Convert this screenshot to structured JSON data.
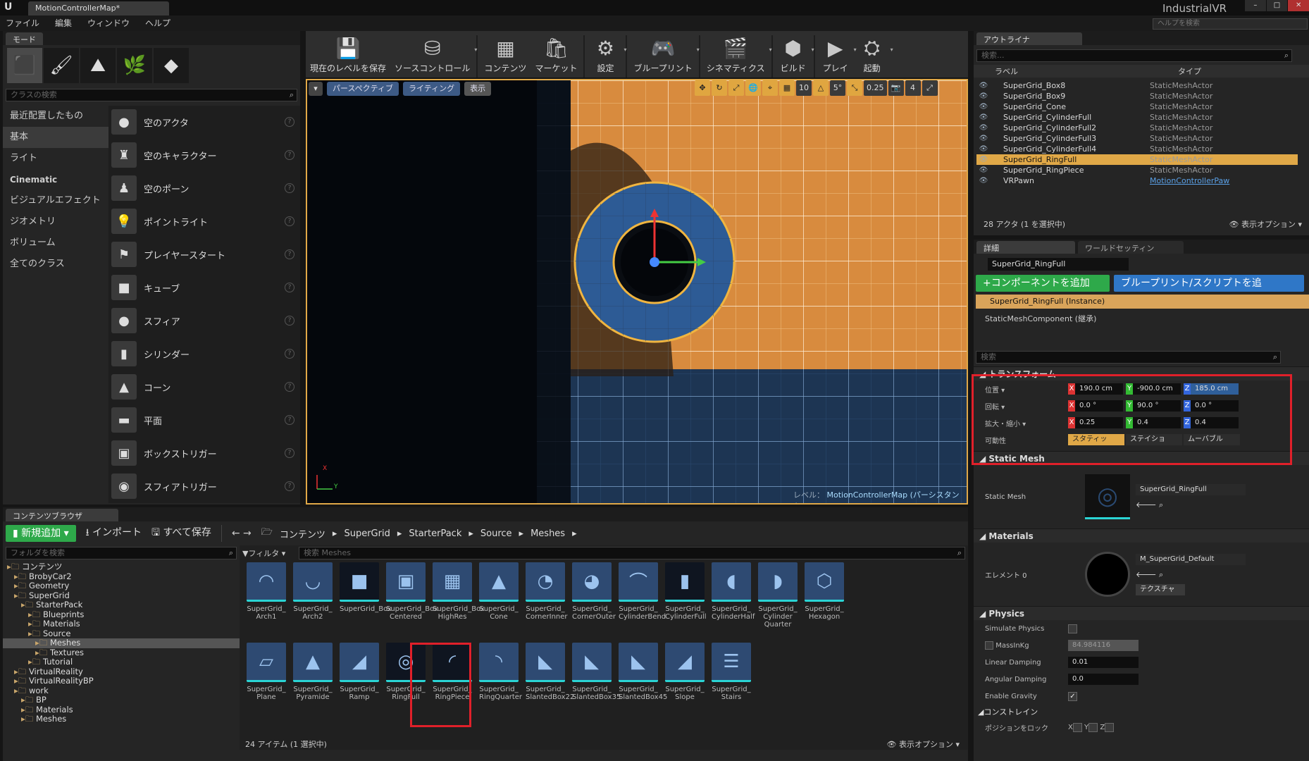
{
  "app": {
    "tab_title": "MotionControllerMap*",
    "project": "IndustrialVR",
    "help_search_placeholder": "ヘルプを検索",
    "logo": "U"
  },
  "menu": [
    "ファイル",
    "編集",
    "ウィンドウ",
    "ヘルプ"
  ],
  "modes": {
    "tab": "モード",
    "search_placeholder": "クラスの検索",
    "categories": [
      "最近配置したもの",
      "基本",
      "ライト",
      "Cinematic",
      "ビジュアルエフェクト",
      "ジオメトリ",
      "ボリューム",
      "全てのクラス"
    ],
    "items": [
      {
        "label": "空のアクタ",
        "icon": "●"
      },
      {
        "label": "空のキャラクター",
        "icon": "♜"
      },
      {
        "label": "空のポーン",
        "icon": "♟"
      },
      {
        "label": "ポイントライト",
        "icon": "💡"
      },
      {
        "label": "プレイヤースタート",
        "icon": "⚑"
      },
      {
        "label": "キューブ",
        "icon": "■"
      },
      {
        "label": "スフィア",
        "icon": "●"
      },
      {
        "label": "シリンダー",
        "icon": "▮"
      },
      {
        "label": "コーン",
        "icon": "▲"
      },
      {
        "label": "平面",
        "icon": "▬"
      },
      {
        "label": "ボックストリガー",
        "icon": "▣"
      },
      {
        "label": "スフィアトリガー",
        "icon": "◉"
      }
    ]
  },
  "toolbar": [
    {
      "label": "現在のレベルを保存",
      "icon": "💾",
      "arrow": ""
    },
    {
      "label": "ソースコントロール",
      "icon": "⛁",
      "arrow": "▾"
    },
    {
      "label": "コンテンツ",
      "icon": "▦",
      "arrow": ""
    },
    {
      "label": "マーケット",
      "icon": "🛍",
      "arrow": ""
    },
    {
      "label": "設定",
      "icon": "⚙",
      "arrow": "▾"
    },
    {
      "label": "ブループリント",
      "icon": "🎮",
      "arrow": "▾"
    },
    {
      "label": "シネマティクス",
      "icon": "🎬",
      "arrow": "▾"
    },
    {
      "label": "ビルド",
      "icon": "⬢",
      "arrow": "▾"
    },
    {
      "label": "プレイ",
      "icon": "▶",
      "arrow": "▾"
    },
    {
      "label": "起動",
      "icon": "⛭",
      "arrow": "▾"
    }
  ],
  "viewport": {
    "perspective": "パースペクティブ",
    "lighting": "ライティング",
    "show": "表示",
    "grid_snap": "5°",
    "scale_snap": "0.25",
    "cam_speed": "4",
    "level_label": "レベル：",
    "level_name": "MotionControllerMap (パーシスタント)",
    "axis_x": "X",
    "axis_y": "Y"
  },
  "outliner": {
    "tab": "アウトライナ",
    "search_placeholder": "検索...",
    "col_label": "ラベル",
    "col_type": "タイプ",
    "rows": [
      {
        "name": "SuperGrid_Box8",
        "type": "StaticMeshActor"
      },
      {
        "name": "SuperGrid_Box9",
        "type": "StaticMeshActor"
      },
      {
        "name": "SuperGrid_Cone",
        "type": "StaticMeshActor"
      },
      {
        "name": "SuperGrid_CylinderFull",
        "type": "StaticMeshActor"
      },
      {
        "name": "SuperGrid_CylinderFull2",
        "type": "StaticMeshActor"
      },
      {
        "name": "SuperGrid_CylinderFull3",
        "type": "StaticMeshActor"
      },
      {
        "name": "SuperGrid_CylinderFull4",
        "type": "StaticMeshActor"
      },
      {
        "name": "SuperGrid_RingFull",
        "type": "StaticMeshActor"
      },
      {
        "name": "SuperGrid_RingPiece",
        "type": "StaticMeshActor"
      },
      {
        "name": "VRPawn",
        "type": "MotionControllerPaw"
      }
    ],
    "status": "28 アクタ (1 を選択中)",
    "view_options": "表示オプション"
  },
  "details": {
    "tab": "詳細",
    "tab2": "ワールドセッティン",
    "name": "SuperGrid_RingFull",
    "add_component": "+コンポーネントを追加",
    "blueprint": "ブループリント/スクリプトを追",
    "instance": "SuperGrid_RingFull (Instance)",
    "component": "StaticMeshComponent (継承)",
    "search_placeholder": "検索",
    "transform": {
      "header": "トランスフォーム",
      "location_label": "位置",
      "rotation_label": "回転",
      "scale_label": "拡大・縮小",
      "mobility_label": "可動性",
      "loc": [
        "190.0 cm",
        "-900.0 cm",
        "185.0 cm"
      ],
      "rot": [
        "0.0 °",
        "90.0 °",
        "0.0 °"
      ],
      "scale": [
        "0.25",
        "0.4",
        "0.4"
      ],
      "mobility": [
        "スタティッ",
        "ステイショ",
        "ムーバブル"
      ]
    },
    "static_mesh": {
      "header": "Static Mesh",
      "label": "Static Mesh",
      "value": "SuperGrid_RingFull"
    },
    "materials": {
      "header": "Materials",
      "label": "エレメント 0",
      "value": "M_SuperGrid_Default",
      "texture": "テクスチャ"
    },
    "physics": {
      "header": "Physics",
      "simulate": "Simulate Physics",
      "mass": "MassInKg",
      "mass_val": "84.984116",
      "lin_damp": "Linear Damping",
      "lin_val": "0.01",
      "ang_damp": "Angular Damping",
      "ang_val": "0.0",
      "gravity": "Enable Gravity"
    },
    "constraints": {
      "header": "コンストレイン",
      "lock_pos": "ポジションをロック",
      "x": "X",
      "y": "Y",
      "z": "Z"
    }
  },
  "content": {
    "tab": "コンテンツブラウザ",
    "add_new": "新規追加",
    "import": "インポート",
    "save_all": "すべて保存",
    "breadcrumb": [
      "コンテンツ",
      "SuperGrid",
      "StarterPack",
      "Source",
      "Meshes"
    ],
    "folder_search": "フォルダを検索",
    "filter": "フィルタ",
    "asset_search": "検索 Meshes",
    "tree": [
      "コンテンツ",
      "BrobyCar2",
      "Geometry",
      "SuperGrid",
      "StarterPack",
      "Blueprints",
      "Materials",
      "Source",
      "Meshes",
      "Textures",
      "Tutorial",
      "VirtualReality",
      "VirtualRealityBP",
      "work",
      "BP",
      "Materials",
      "Meshes"
    ],
    "assets_row1": [
      "SuperGrid_\nArch1",
      "SuperGrid_\nArch2",
      "SuperGrid_Box",
      "SuperGrid_Box\nCentered",
      "SuperGrid_Box\nHighRes",
      "SuperGrid_\nCone",
      "SuperGrid_\nCornerInner",
      "SuperGrid_\nCornerOuter",
      "SuperGrid_\nCylinderBend",
      "SuperGrid_\nCylinderFull",
      "SuperGrid_\nCylinderHalf",
      "SuperGrid_\nCylinder\nQuarter",
      "SuperGrid_\nHexagon"
    ],
    "assets_row2": [
      "SuperGrid_\nPlane",
      "SuperGrid_\nPyramide",
      "SuperGrid_\nRamp",
      "SuperGrid_\nRingFull",
      "SuperGrid_\nRingPiece",
      "SuperGrid_\nRingQuarter",
      "SuperGrid_\nSlantedBox22",
      "SuperGrid_\nSlantedBox35",
      "SuperGrid_\nSlantedBox45",
      "SuperGrid_\nSlope",
      "SuperGrid_\nStairs"
    ],
    "status": "24 アイテム (1 選択中)",
    "view_options": "表示オプション"
  },
  "colors": {
    "accent": "#e0a847",
    "selection_red": "#e0202a",
    "green": "#2ea94a",
    "blue": "#2f77c7"
  }
}
